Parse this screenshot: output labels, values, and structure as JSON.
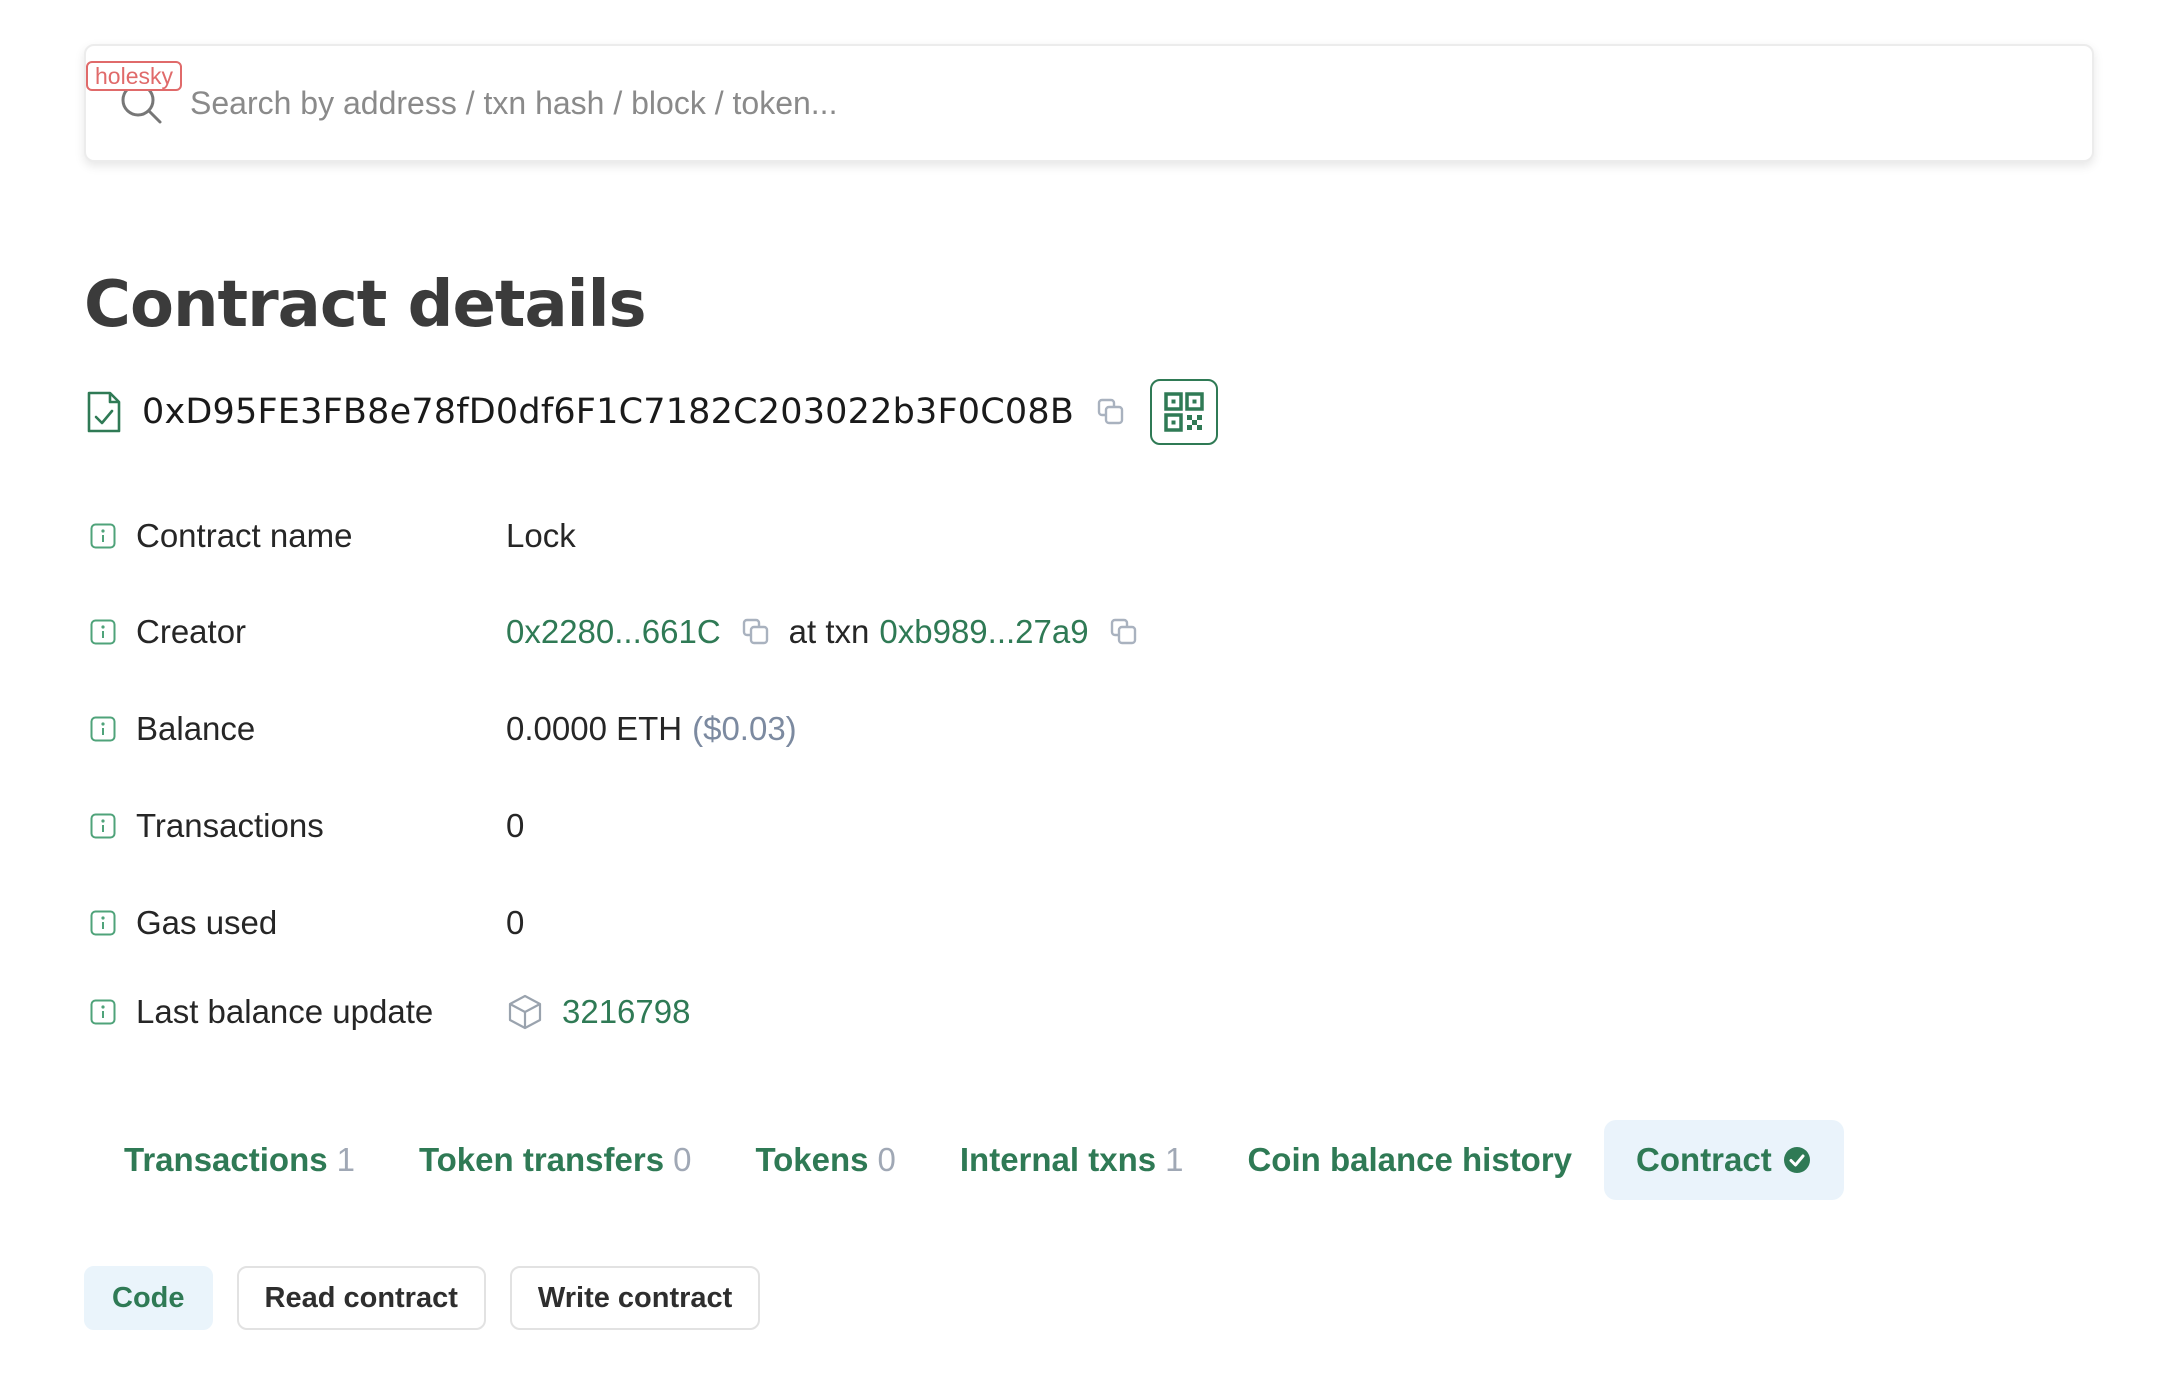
{
  "search": {
    "network_badge": "holesky",
    "placeholder": "Search by address / txn hash / block / token..."
  },
  "page_title": "Contract details",
  "address": "0xD95FE3FB8e78fD0df6F1C7182C203022b3F0C08B",
  "details": {
    "contract_name": {
      "label": "Contract name",
      "value": "Lock"
    },
    "creator": {
      "label": "Creator",
      "address": "0x2280...661C",
      "at_txn_text": "at txn",
      "txn": "0xb989...27a9"
    },
    "balance": {
      "label": "Balance",
      "value": "0.0000 ETH",
      "usd": "($0.03)"
    },
    "transactions": {
      "label": "Transactions",
      "value": "0"
    },
    "gas_used": {
      "label": "Gas used",
      "value": "0"
    },
    "last_balance_update": {
      "label": "Last balance update",
      "value": "3216798"
    }
  },
  "tabs": [
    {
      "label": "Transactions",
      "count": "1"
    },
    {
      "label": "Token transfers",
      "count": "0"
    },
    {
      "label": "Tokens",
      "count": "0"
    },
    {
      "label": "Internal txns",
      "count": "1"
    },
    {
      "label": "Coin balance history"
    },
    {
      "label": "Contract",
      "active": true
    }
  ],
  "subtabs": [
    {
      "label": "Code",
      "active": true
    },
    {
      "label": "Read contract"
    },
    {
      "label": "Write contract"
    }
  ],
  "colors": {
    "accent_green": "#2f7a55",
    "active_tab_bg": "#eaf3fb",
    "badge_red": "#e06a6a",
    "muted_count": "#a0a8b5"
  }
}
